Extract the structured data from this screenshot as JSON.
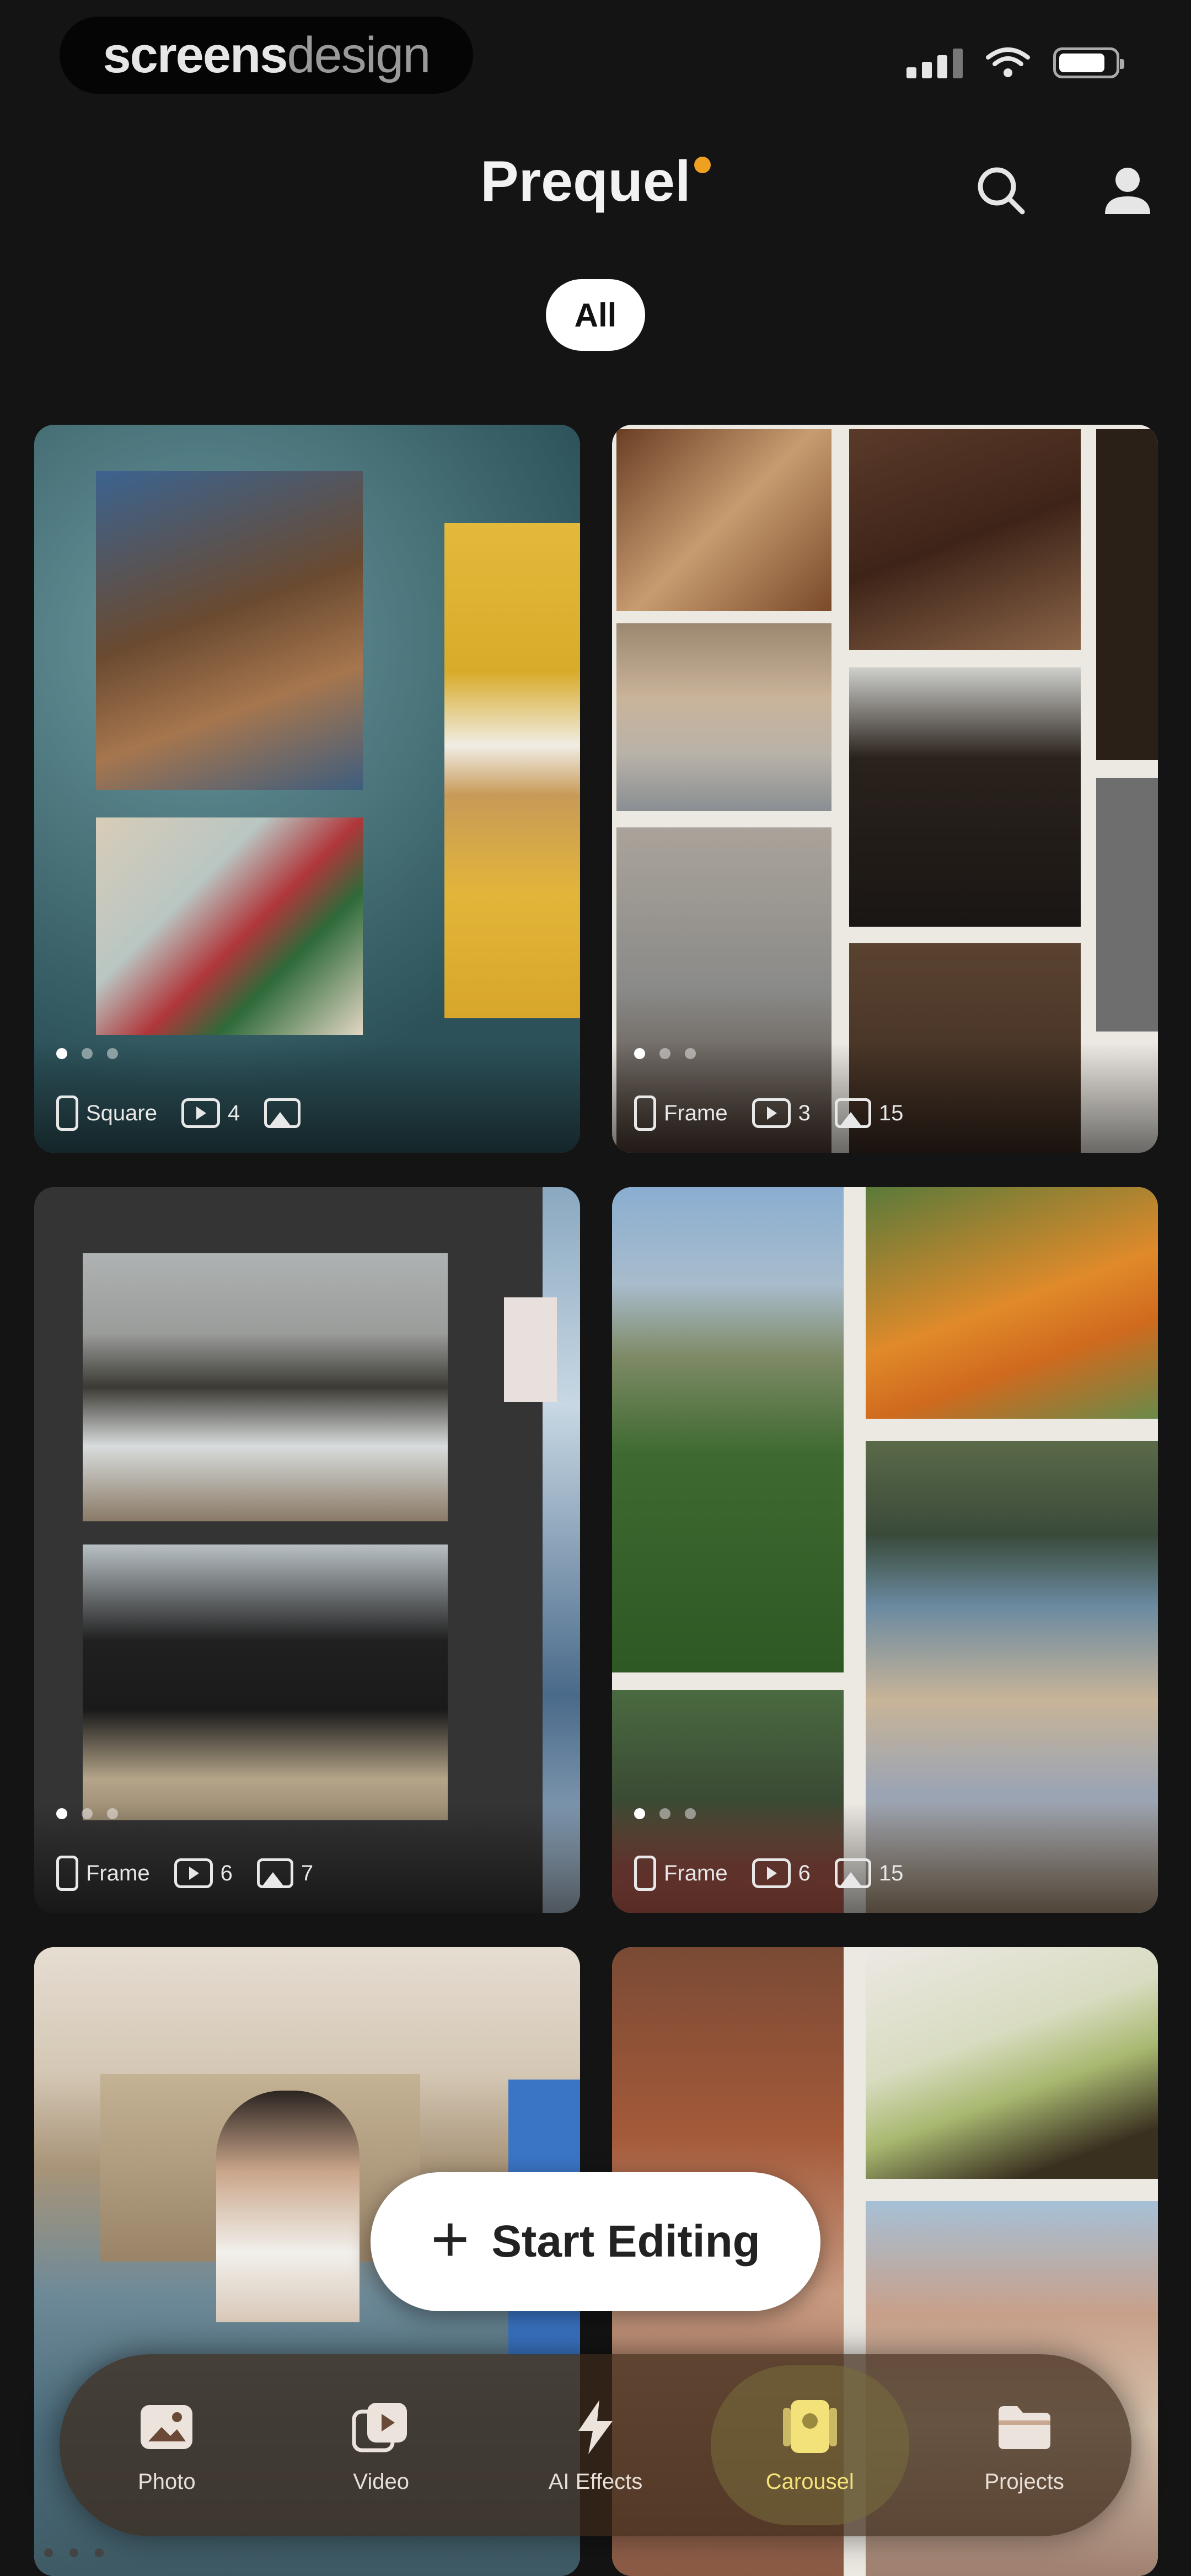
{
  "status_bar": {
    "watermark_part1": "screens",
    "watermark_part2": "design"
  },
  "header": {
    "title": "Prequel"
  },
  "filters": {
    "selected": "All"
  },
  "templates": [
    {
      "frame": "Square",
      "videos": "4",
      "photos": ""
    },
    {
      "frame": "Frame",
      "videos": "3",
      "photos": "15"
    },
    {
      "frame": "Frame",
      "videos": "6",
      "photos": "7"
    },
    {
      "frame": "Frame",
      "videos": "6",
      "photos": "15"
    }
  ],
  "cta": {
    "label": "Start Editing"
  },
  "tabs": [
    {
      "label": "Photo"
    },
    {
      "label": "Video"
    },
    {
      "label": "AI Effects"
    },
    {
      "label": "Carousel"
    },
    {
      "label": "Projects"
    }
  ],
  "colors": {
    "accent": "#f0a020",
    "background": "#141414",
    "active_tab": "#f3e27a"
  }
}
